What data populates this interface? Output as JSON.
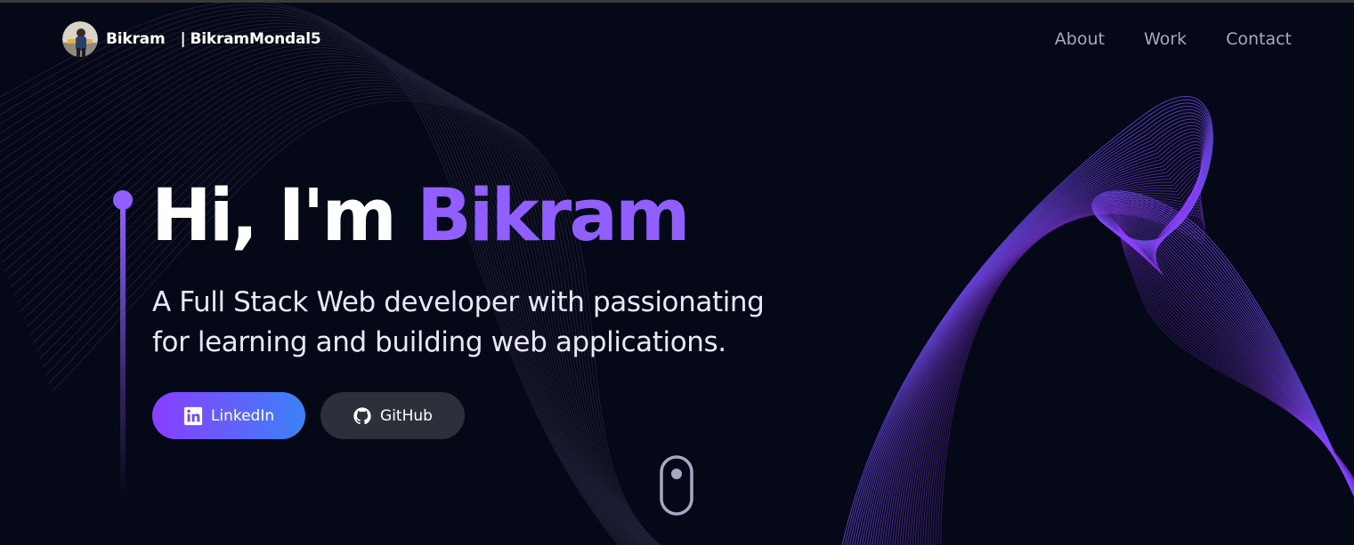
{
  "navbar": {
    "brand_name": "Bikram",
    "brand_sep": "|",
    "brand_handle": "BikramMondal5",
    "links": [
      {
        "label": "About"
      },
      {
        "label": "Work"
      },
      {
        "label": "Contact"
      }
    ]
  },
  "hero": {
    "greeting": "Hi, I'm ",
    "name": "Bikram",
    "subtitle_line1": "A Full Stack Web developer with passionating",
    "subtitle_line2": "for learning and building web applications."
  },
  "buttons": {
    "linkedin_label": "LinkedIn",
    "github_label": "GitHub"
  },
  "icons": {
    "avatar": "avatar-photo",
    "linkedin": "linkedin-icon",
    "github": "github-icon",
    "scroll": "mouse-scroll-icon"
  },
  "colors": {
    "background": "#050816",
    "accent": "#915eff",
    "nav_text": "#aaa6c3",
    "linkedin_gradient_start": "#8b3dff",
    "linkedin_gradient_end": "#3b82f6",
    "github_button": "#2b303b"
  }
}
